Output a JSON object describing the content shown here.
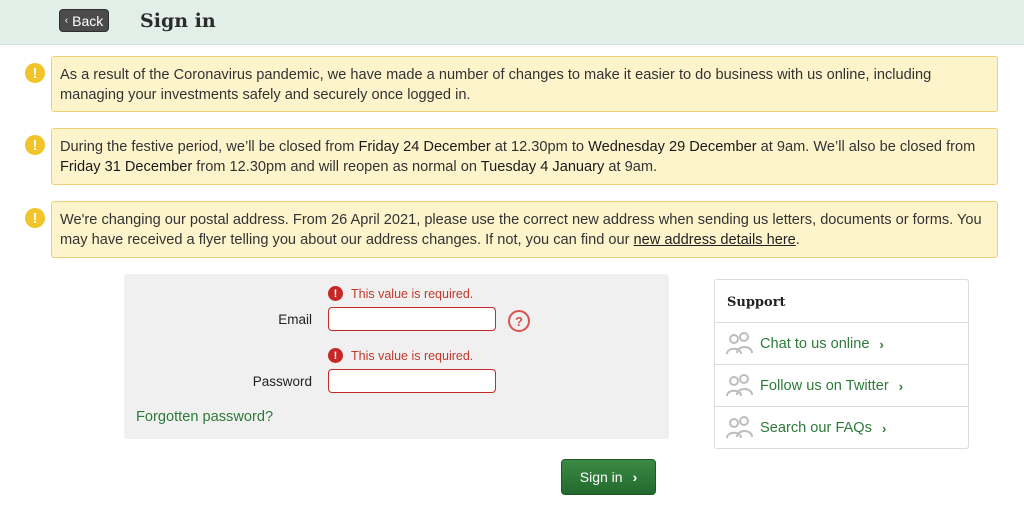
{
  "header": {
    "back_label": "Back",
    "title": "Sign in"
  },
  "notices": [
    {
      "text": "As a result of the Coronavirus pandemic, we have made a number of changes to make it easier to do business with us online, including managing your investments safely and securely once logged in."
    },
    {
      "part1": "During the festive period, we’ll be closed from ",
      "date1": "Friday 24 December",
      "part2": " at 12.30pm to ",
      "date2": "Wednesday 29 December",
      "part3": " at 9am. We’ll also be closed from ",
      "date3": "Friday 31 December",
      "part4": " from 12.30pm and will reopen as normal on ",
      "date4": "Tuesday 4 January",
      "part5": " at 9am."
    },
    {
      "text": "We're changing our postal address. From 26 April 2021, please use the correct new address when sending us letters, documents or forms. You may have received a flyer telling you about our address changes. If not, you can find our ",
      "link": "new address details here",
      "end": "."
    }
  ],
  "login": {
    "email_error": "This value is required.",
    "email_label": "Email",
    "email_value": "",
    "password_error": "This value is required.",
    "password_label": "Password",
    "password_value": "",
    "forgot_label": "Forgotten password?",
    "signin_label": "Sign in"
  },
  "support": {
    "title": "Support",
    "items": [
      {
        "label": "Chat to us online"
      },
      {
        "label": "Follow us on Twitter"
      },
      {
        "label": "Search our FAQs"
      }
    ]
  },
  "colors": {
    "header_bg": "#e2efe9",
    "notice_bg": "#fdf4cc",
    "notice_border": "#f0cf7a",
    "error": "#c62828",
    "brand_green": "#2e7a3a"
  },
  "icons": {
    "notice": "warning-icon",
    "error": "error-icon",
    "help": "help-icon",
    "support": "people-icon",
    "chevron": "chevron-right-icon"
  }
}
